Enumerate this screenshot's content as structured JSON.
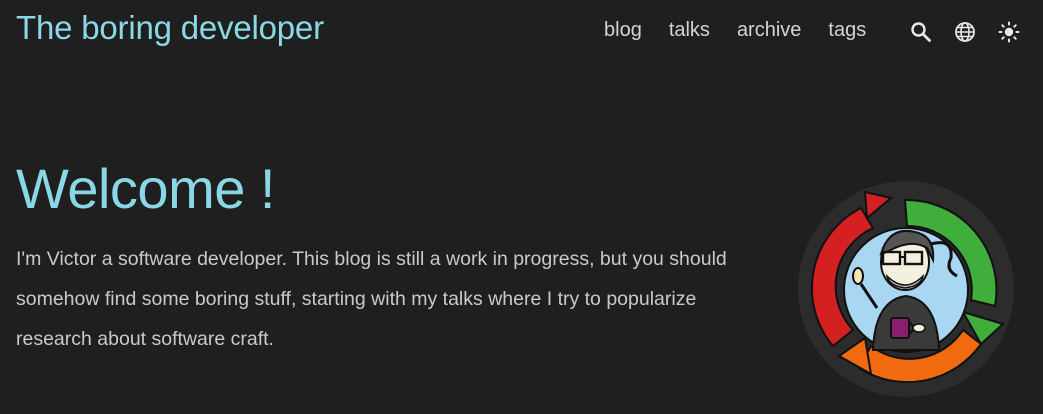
{
  "header": {
    "site_title": "The boring developer",
    "nav": [
      {
        "label": "blog"
      },
      {
        "label": "talks"
      },
      {
        "label": "archive"
      },
      {
        "label": "tags"
      }
    ],
    "icons": [
      "search-icon",
      "globe-icon",
      "sun-icon"
    ]
  },
  "main": {
    "heading": "Welcome !",
    "intro_before": "I'm Victor a software developer. This blog is still a work in progress, but you should somehow find some boring stuff, starting with my ",
    "intro_link": "talks",
    "intro_after": " where I try to popularize research about software craft."
  },
  "colors": {
    "background": "#1f1f1f",
    "accent": "#8ad8e6",
    "text": "#c9c9c9"
  }
}
